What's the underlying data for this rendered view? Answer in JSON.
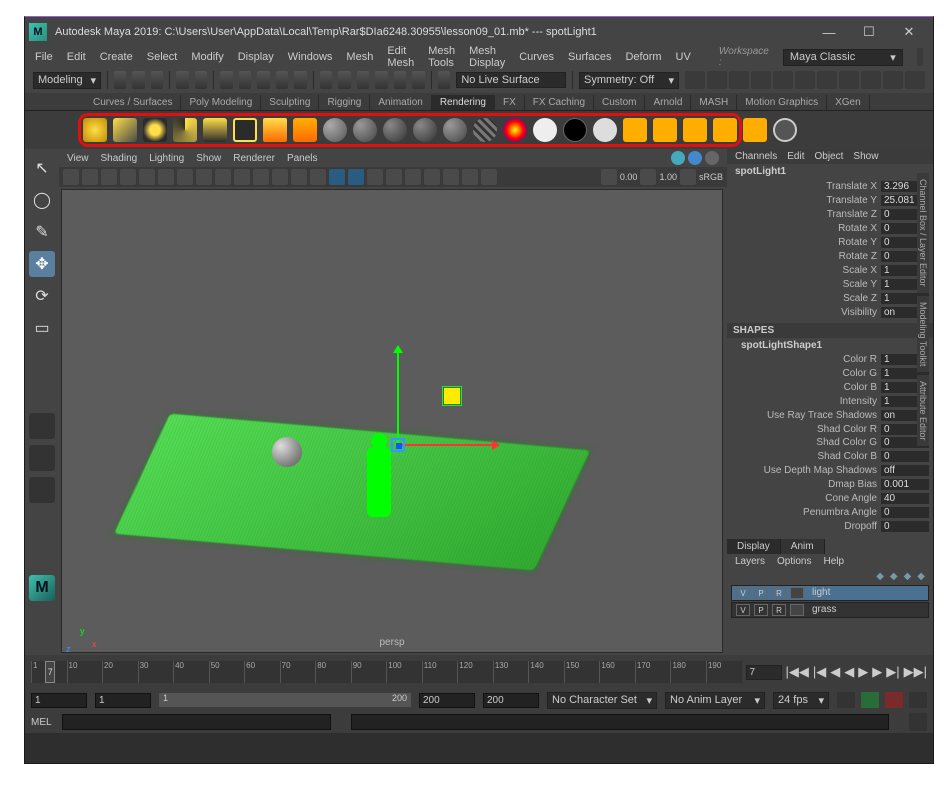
{
  "title": "Autodesk Maya 2019: C:\\Users\\User\\AppData\\Local\\Temp\\Rar$DIa6248.30955\\lesson09_01.mb*  ---  spotLight1",
  "menubar": [
    "File",
    "Edit",
    "Create",
    "Select",
    "Modify",
    "Display",
    "Windows",
    "Mesh",
    "Edit Mesh",
    "Mesh Tools",
    "Mesh Display",
    "Curves",
    "Surfaces",
    "Deform",
    "UV"
  ],
  "workspace_label": "Workspace :",
  "workspace_value": "Maya Classic",
  "modeling_dropdown": "Modeling",
  "no_live_surface": "No Live Surface",
  "symmetry": "Symmetry: Off",
  "shelf_tabs": [
    "Curves / Surfaces",
    "Poly Modeling",
    "Sculpting",
    "Rigging",
    "Animation",
    "Rendering",
    "FX",
    "FX Caching",
    "Custom",
    "Arnold",
    "MASH",
    "Motion Graphics",
    "XGen"
  ],
  "shelf_active_tab": "Rendering",
  "panel_menus": [
    "View",
    "Shading",
    "Lighting",
    "Show",
    "Renderer",
    "Panels"
  ],
  "viewport_label": "persp",
  "channel": {
    "tabs": [
      "Channels",
      "Edit",
      "Object",
      "Show"
    ],
    "object": "spotLight1",
    "attrs": [
      {
        "label": "Translate X",
        "value": "3.296"
      },
      {
        "label": "Translate Y",
        "value": "25.081"
      },
      {
        "label": "Translate Z",
        "value": "0"
      },
      {
        "label": "Rotate X",
        "value": "0"
      },
      {
        "label": "Rotate Y",
        "value": "0"
      },
      {
        "label": "Rotate Z",
        "value": "0"
      },
      {
        "label": "Scale X",
        "value": "1"
      },
      {
        "label": "Scale Y",
        "value": "1"
      },
      {
        "label": "Scale Z",
        "value": "1"
      },
      {
        "label": "Visibility",
        "value": "on"
      }
    ],
    "shapes_header": "SHAPES",
    "shape_name": "spotLightShape1",
    "shape_attrs": [
      {
        "label": "Color R",
        "value": "1"
      },
      {
        "label": "Color G",
        "value": "1"
      },
      {
        "label": "Color B",
        "value": "1"
      },
      {
        "label": "Intensity",
        "value": "1"
      },
      {
        "label": "Use Ray Trace Shadows",
        "value": "on"
      },
      {
        "label": "Shad Color R",
        "value": "0"
      },
      {
        "label": "Shad Color G",
        "value": "0"
      },
      {
        "label": "Shad Color B",
        "value": "0"
      },
      {
        "label": "Use Depth Map Shadows",
        "value": "off"
      },
      {
        "label": "Dmap Bias",
        "value": "0.001"
      },
      {
        "label": "Cone Angle",
        "value": "40"
      },
      {
        "label": "Penumbra Angle",
        "value": "0"
      },
      {
        "label": "Dropoff",
        "value": "0"
      }
    ],
    "display_tabs": [
      "Display",
      "Anim"
    ],
    "layer_menus": [
      "Layers",
      "Options",
      "Help"
    ],
    "layers": [
      {
        "v": "V",
        "p": "P",
        "r": "R",
        "name": "light",
        "selected": true
      },
      {
        "v": "V",
        "p": "P",
        "r": "R",
        "name": "grass",
        "selected": false
      }
    ]
  },
  "side_tabs": [
    "Channel Box / Layer Editor",
    "Modeling Toolkit",
    "Attribute Editor"
  ],
  "timeline": {
    "start_field": "7",
    "ticks": [
      "1",
      "10",
      "20",
      "30",
      "40",
      "50",
      "60",
      "70",
      "80",
      "90",
      "100",
      "110",
      "120",
      "130",
      "140",
      "150",
      "160",
      "170",
      "180",
      "190"
    ],
    "current": "7"
  },
  "range": {
    "f1": "1",
    "f2": "1",
    "inner_start": "1",
    "inner_end": "200",
    "f3": "200",
    "f4": "200",
    "char_set": "No Character Set",
    "anim_layer": "No Anim Layer",
    "fps": "24 fps"
  },
  "mel_label": "MEL",
  "panel_toolbar_numbers": {
    "zero": "0.00",
    "one": "1.00",
    "mode": "sRGB"
  }
}
